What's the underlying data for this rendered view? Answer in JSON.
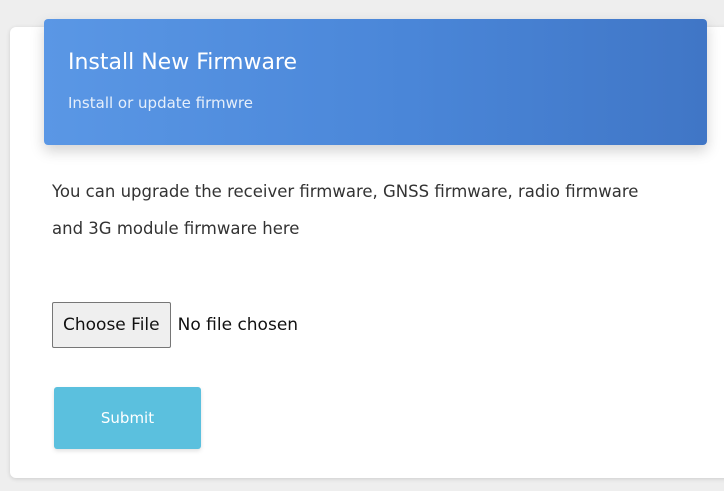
{
  "header": {
    "title": "Install New Firmware",
    "subtitle": "Install or update firmwre"
  },
  "content": {
    "description": "You can upgrade the receiver firmware, GNSS firmware, radio firmware and 3G module firmware here"
  },
  "file_input": {
    "button_label": "Choose File",
    "status_text": "No file chosen"
  },
  "submit": {
    "label": "Submit"
  },
  "colors": {
    "header_gradient_start": "#5a97e5",
    "header_gradient_end": "#4076c6",
    "submit_button": "#5bc0de",
    "page_background": "#eeeeee",
    "card_background": "#ffffff"
  }
}
